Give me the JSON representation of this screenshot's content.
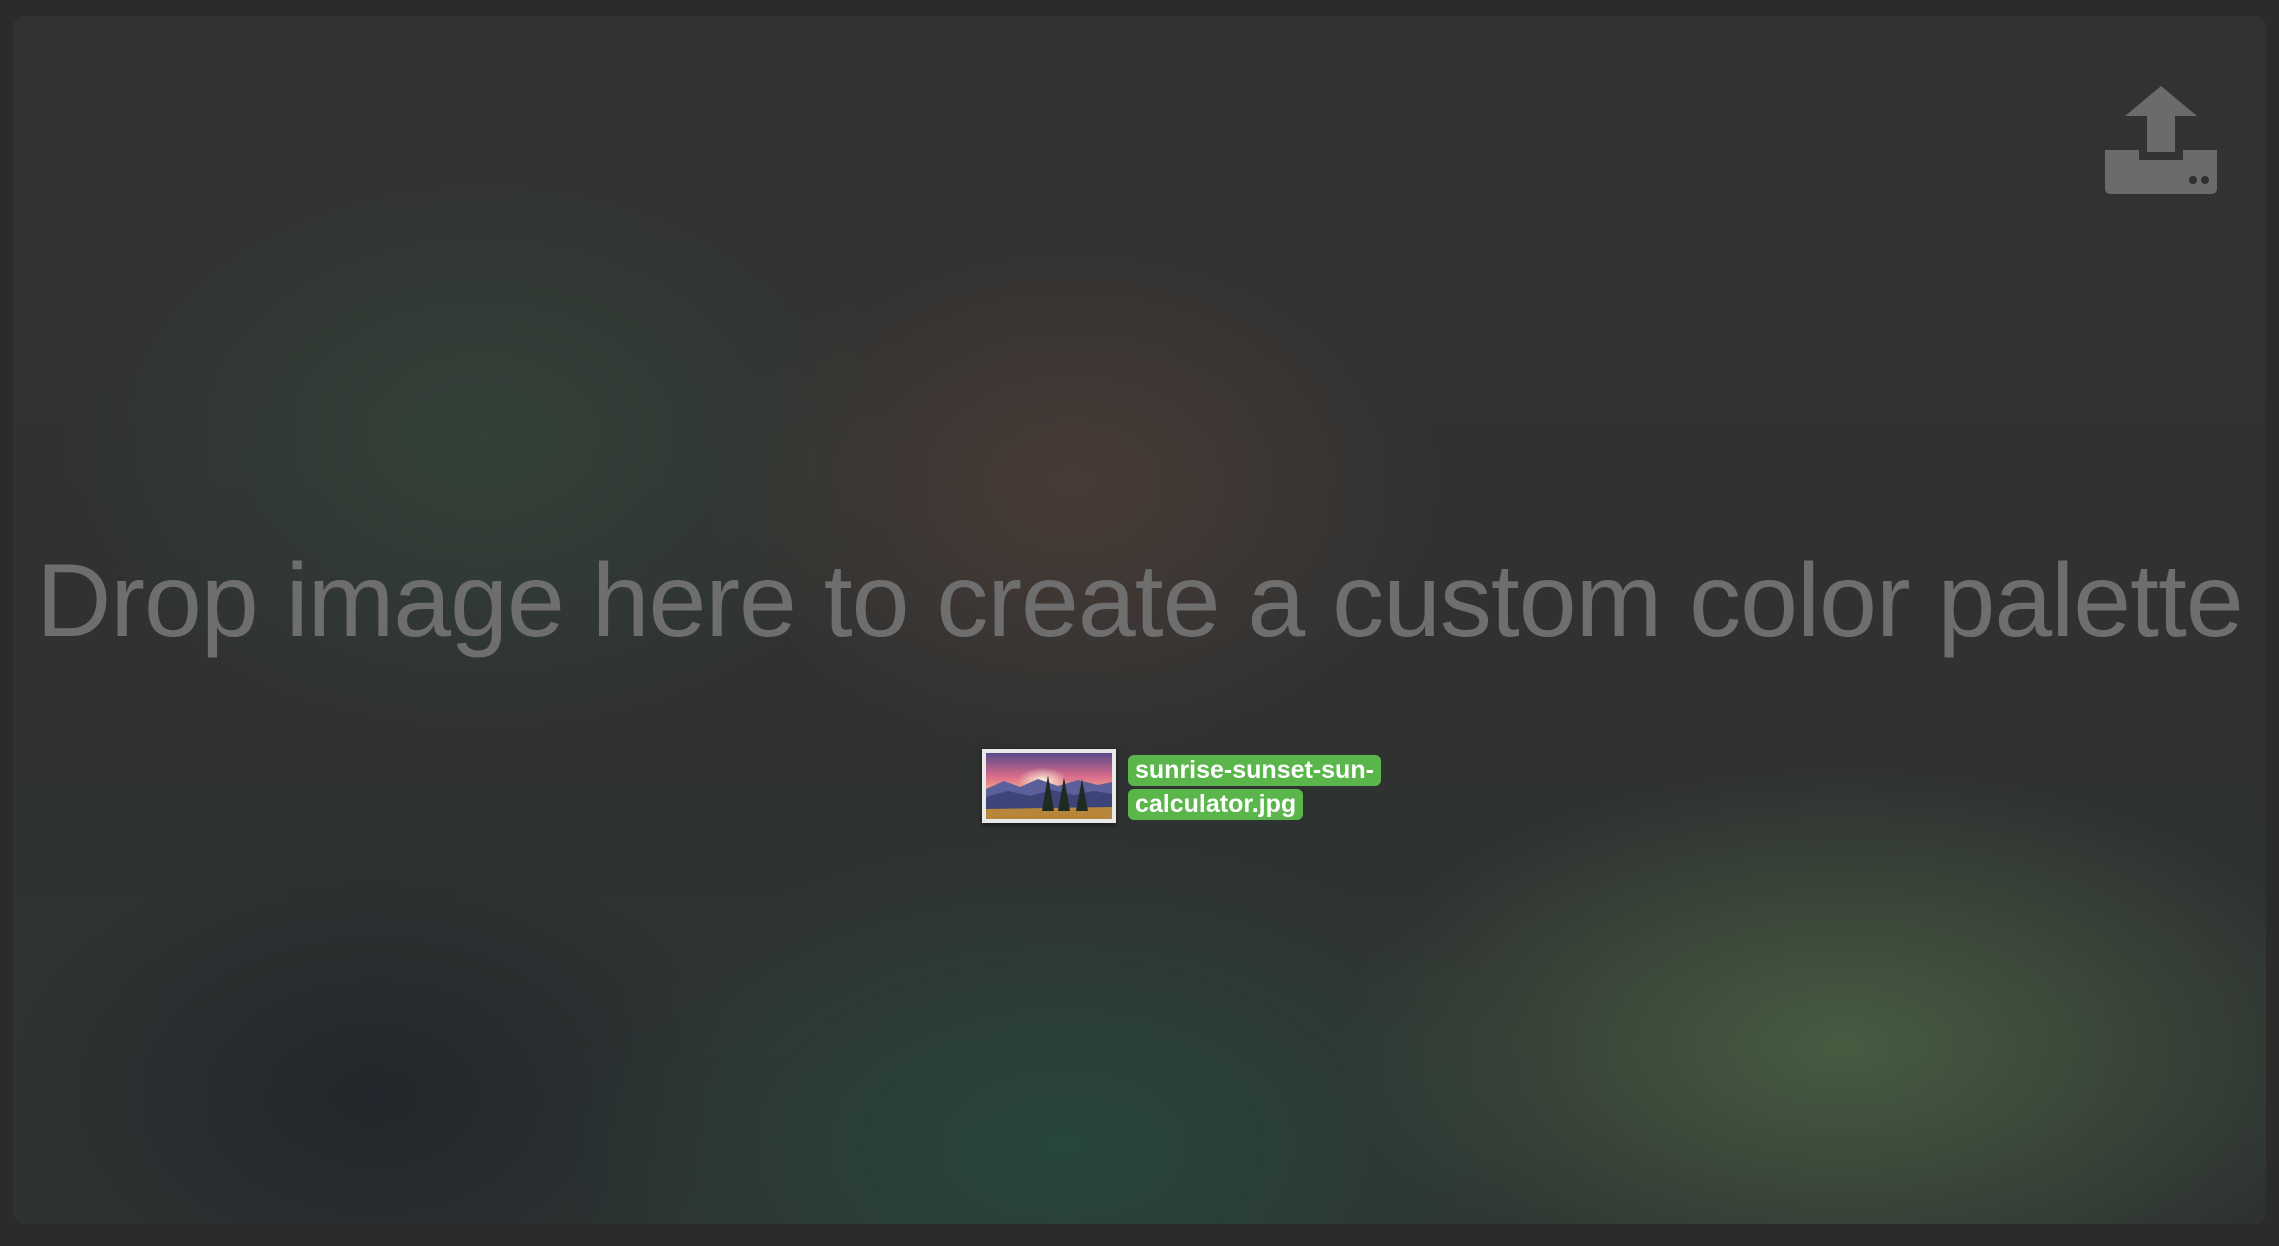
{
  "dropzone": {
    "headline": "Drop image here to create a custom color palette",
    "upload_icon": "upload-to-drive-icon",
    "dragged_file": {
      "name_line1": "sunrise-sunset-sun-",
      "name_line2": "calculator.jpg",
      "thumbnail": "mountain-sunset-thumbnail",
      "label_color": "#5ab54a"
    }
  },
  "colors": {
    "background": "#2b2b2b",
    "headline_text": "#6e6e6e",
    "icon": "#6b6b6b",
    "label_highlight": "#5ab54a"
  }
}
